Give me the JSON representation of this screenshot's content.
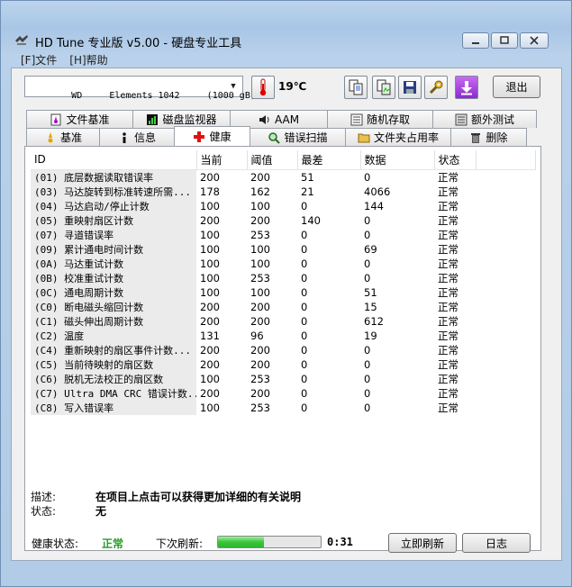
{
  "window": {
    "title": "HD Tune 专业版 v5.00 - 硬盘专业工具",
    "min_icon": "minimize-icon",
    "max_icon": "maximize-icon",
    "close_icon": "close-icon"
  },
  "menu": {
    "file": "[F]文件",
    "help": "[H]帮助"
  },
  "toolbar": {
    "drive": "WD     Elements 1042     (1000 gB)",
    "temperature": "19℃",
    "exit": "退出"
  },
  "tabs_row1": [
    "文件基准",
    "磁盘监视器",
    "AAM",
    "随机存取",
    "额外测试"
  ],
  "tabs_row2": [
    "基准",
    "信息",
    "健康",
    "错误扫描",
    "文件夹占用率",
    "删除"
  ],
  "active_tab": "健康",
  "table": {
    "headers": [
      "ID",
      "当前",
      "阈值",
      "最差",
      "数据",
      "状态"
    ],
    "rows": [
      {
        "id": "(01) 底层数据读取错误率",
        "cur": "200",
        "thr": "200",
        "worst": "51",
        "data": "0",
        "status": "正常"
      },
      {
        "id": "(03) 马达旋转到标准转速所需...",
        "cur": "178",
        "thr": "162",
        "worst": "21",
        "data": "4066",
        "status": "正常"
      },
      {
        "id": "(04) 马达启动/停止计数",
        "cur": "100",
        "thr": "100",
        "worst": "0",
        "data": "144",
        "status": "正常"
      },
      {
        "id": "(05) 重映射扇区计数",
        "cur": "200",
        "thr": "200",
        "worst": "140",
        "data": "0",
        "status": "正常"
      },
      {
        "id": "(07) 寻道错误率",
        "cur": "100",
        "thr": "253",
        "worst": "0",
        "data": "0",
        "status": "正常"
      },
      {
        "id": "(09) 累计通电时间计数",
        "cur": "100",
        "thr": "100",
        "worst": "0",
        "data": "69",
        "status": "正常"
      },
      {
        "id": "(0A) 马达重试计数",
        "cur": "100",
        "thr": "100",
        "worst": "0",
        "data": "0",
        "status": "正常"
      },
      {
        "id": "(0B) 校准重试计数",
        "cur": "100",
        "thr": "253",
        "worst": "0",
        "data": "0",
        "status": "正常"
      },
      {
        "id": "(0C) 通电周期计数",
        "cur": "100",
        "thr": "100",
        "worst": "0",
        "data": "51",
        "status": "正常"
      },
      {
        "id": "(C0) 断电磁头缩回计数",
        "cur": "200",
        "thr": "200",
        "worst": "0",
        "data": "15",
        "status": "正常"
      },
      {
        "id": "(C1) 磁头伸出周期计数",
        "cur": "200",
        "thr": "200",
        "worst": "0",
        "data": "612",
        "status": "正常"
      },
      {
        "id": "(C2) 温度",
        "cur": "131",
        "thr": "96",
        "worst": "0",
        "data": "19",
        "status": "正常"
      },
      {
        "id": "(C4) 重新映射的扇区事件计数...",
        "cur": "200",
        "thr": "200",
        "worst": "0",
        "data": "0",
        "status": "正常"
      },
      {
        "id": "(C5) 当前待映射的扇区数",
        "cur": "200",
        "thr": "200",
        "worst": "0",
        "data": "0",
        "status": "正常"
      },
      {
        "id": "(C6) 脱机无法校正的扇区数",
        "cur": "100",
        "thr": "253",
        "worst": "0",
        "data": "0",
        "status": "正常"
      },
      {
        "id": "(C7) Ultra DMA CRC 错误计数...",
        "cur": "200",
        "thr": "200",
        "worst": "0",
        "data": "0",
        "status": "正常"
      },
      {
        "id": "(C8) 写入错误率",
        "cur": "100",
        "thr": "253",
        "worst": "0",
        "data": "0",
        "status": "正常"
      }
    ]
  },
  "description": {
    "desc_label": "描述:",
    "desc_value": "在项目上点击可以获得更加详细的有关说明",
    "status_label": "状态:",
    "status_value": "无"
  },
  "status_bar": {
    "health_label": "健康状态:",
    "health_value": "正常",
    "refresh_label": "下次刷新:",
    "refresh_progress": 0.45,
    "countdown": "0:31",
    "refresh_now": "立即刷新",
    "log": "日志"
  },
  "colors": {
    "health_ok": "#2a9a2a",
    "progress": "#3cc43c"
  }
}
